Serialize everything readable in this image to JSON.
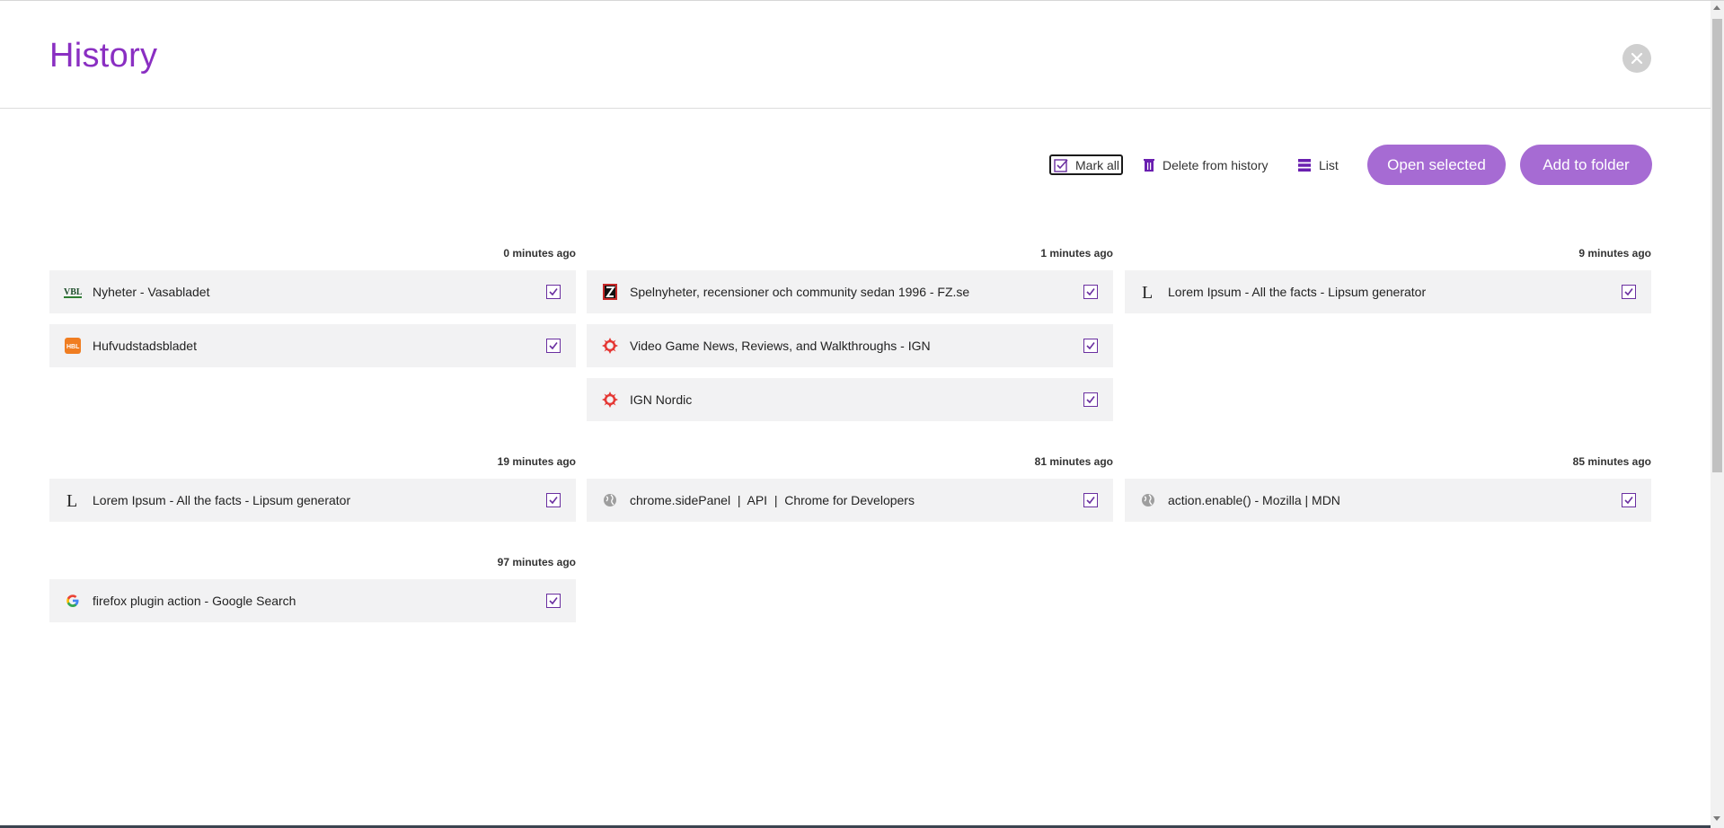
{
  "header": {
    "title": "History"
  },
  "toolbar": {
    "mark_all": "Mark all",
    "delete": "Delete from history",
    "list": "List",
    "open_selected": "Open selected",
    "add_to_folder": "Add to folder"
  },
  "colors": {
    "accent": "#8a2fc2",
    "button": "#a66bd3",
    "card_bg": "#f2f2f3"
  },
  "groups": [
    {
      "time": "0 minutes ago",
      "items": [
        {
          "title": "Nyheter - Vasabladet",
          "icon": "vbl-icon",
          "checked": true
        },
        {
          "title": "Hufvudstadsbladet",
          "icon": "hbl-icon",
          "checked": true
        }
      ]
    },
    {
      "time": "1 minutes ago",
      "items": [
        {
          "title": "Spelnyheter, recensioner och community sedan 1996 - FZ.se",
          "icon": "fz-icon",
          "checked": true
        },
        {
          "title": "Video Game News, Reviews, and Walkthroughs - IGN",
          "icon": "ign-icon",
          "checked": true
        },
        {
          "title": "IGN Nordic",
          "icon": "ign-icon",
          "checked": true
        }
      ]
    },
    {
      "time": "9 minutes ago",
      "items": [
        {
          "title": "Lorem Ipsum - All the facts - Lipsum generator",
          "icon": "lipsum-icon",
          "checked": true
        }
      ]
    },
    {
      "time": "19 minutes ago",
      "items": [
        {
          "title": "Lorem Ipsum - All the facts - Lipsum generator",
          "icon": "lipsum-icon",
          "checked": true
        }
      ]
    },
    {
      "time": "81 minutes ago",
      "items": [
        {
          "title": "chrome.sidePanel  |  API  |  Chrome for Developers",
          "icon": "globe-icon",
          "checked": true
        }
      ]
    },
    {
      "time": "85 minutes ago",
      "items": [
        {
          "title": "action.enable() - Mozilla | MDN",
          "icon": "globe-icon",
          "checked": true
        }
      ]
    },
    {
      "time": "97 minutes ago",
      "items": [
        {
          "title": "firefox plugin action - Google Search",
          "icon": "google-icon",
          "checked": true
        }
      ]
    }
  ]
}
